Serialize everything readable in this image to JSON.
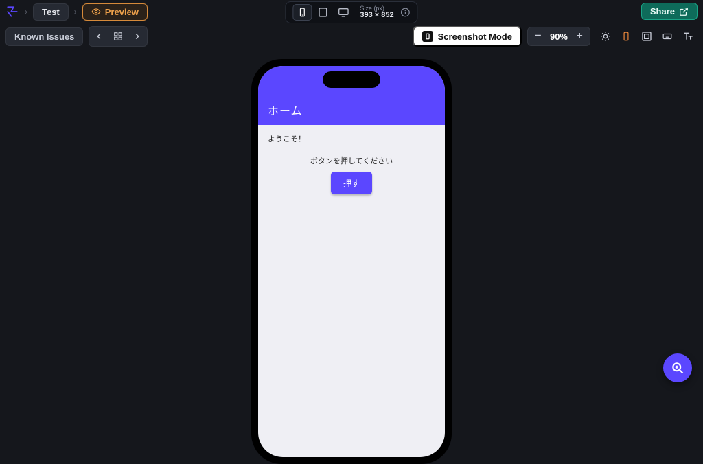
{
  "topbar": {
    "breadcrumb_project": "Test",
    "preview_label": "Preview",
    "share_label": "Share"
  },
  "device": {
    "size_label": "Size (px)",
    "size_value": "393 × 852"
  },
  "secondbar": {
    "known_issues_label": "Known Issues",
    "screenshot_mode_label": "Screenshot Mode",
    "zoom_label": "90%"
  },
  "app": {
    "header_title": "ホーム",
    "welcome": "ようこそ！",
    "instruction": "ボタンを押してください",
    "button_label": "押す"
  },
  "colors": {
    "accent": "#5b47ff",
    "preview_border": "#d68a3a",
    "share_bg": "#0e6b5a"
  }
}
